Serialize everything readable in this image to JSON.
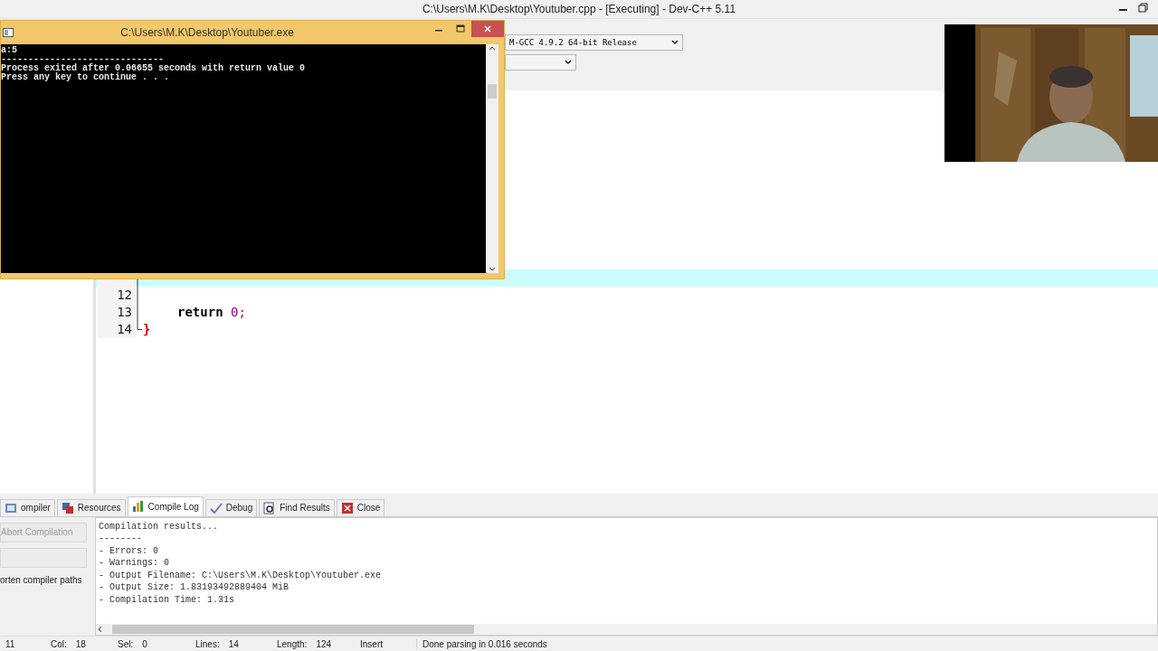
{
  "window": {
    "title": "C:\\Users\\M.K\\Desktop\\Youtuber.cpp - [Executing] - Dev-C++ 5.11"
  },
  "toolbar": {
    "compiler_select": "M-GCC 4.9.2 64-bit Release"
  },
  "editor": {
    "lines": [
      {
        "highlighted": true
      },
      {
        "highlighted": false,
        "number": "12"
      },
      {
        "highlighted": false,
        "number": "13",
        "tokens": [
          {
            "text": "return ",
            "kind": "keyword"
          },
          {
            "text": "0",
            "kind": "number"
          },
          {
            "text": ";",
            "kind": "symbol"
          }
        ]
      },
      {
        "highlighted": false,
        "number": "14",
        "tokens": [
          {
            "text": "}",
            "kind": "brace"
          }
        ]
      }
    ]
  },
  "console": {
    "title": "C:\\Users\\M.K\\Desktop\\Youtuber.exe",
    "lines": [
      "a:5",
      "------------------------------",
      "Process exited after 0.06655 seconds with return value 0",
      "Press any key to continue . . ."
    ]
  },
  "bottom_panel": {
    "tabs": [
      {
        "label": "ompiler",
        "selected": false
      },
      {
        "label": "Resources",
        "selected": false
      },
      {
        "label": "Compile Log",
        "selected": true
      },
      {
        "label": "Debug",
        "selected": false
      },
      {
        "label": "Find Results",
        "selected": false
      },
      {
        "label": "Close",
        "selected": false
      }
    ],
    "abort_button": {
      "label": "Abort Compilation",
      "disabled": true
    },
    "option_label": "orten compiler paths",
    "log": [
      "Compilation results...",
      "--------",
      "- Errors: 0",
      "- Warnings: 0",
      "- Output Filename: C:\\Users\\M.K\\Desktop\\Youtuber.exe",
      "- Output Size: 1.83193492889404 MiB",
      "- Compilation Time: 1.31s"
    ]
  },
  "status_bar": [
    {
      "value": "11"
    },
    {
      "label": "Col:",
      "value": "18"
    },
    {
      "label": "Sel:",
      "value": "0"
    },
    {
      "label": "Lines:",
      "value": "14"
    },
    {
      "label": "Length:",
      "value": "124"
    },
    {
      "value": "Insert"
    },
    {
      "value": "Done parsing in 0.016 seconds"
    }
  ]
}
